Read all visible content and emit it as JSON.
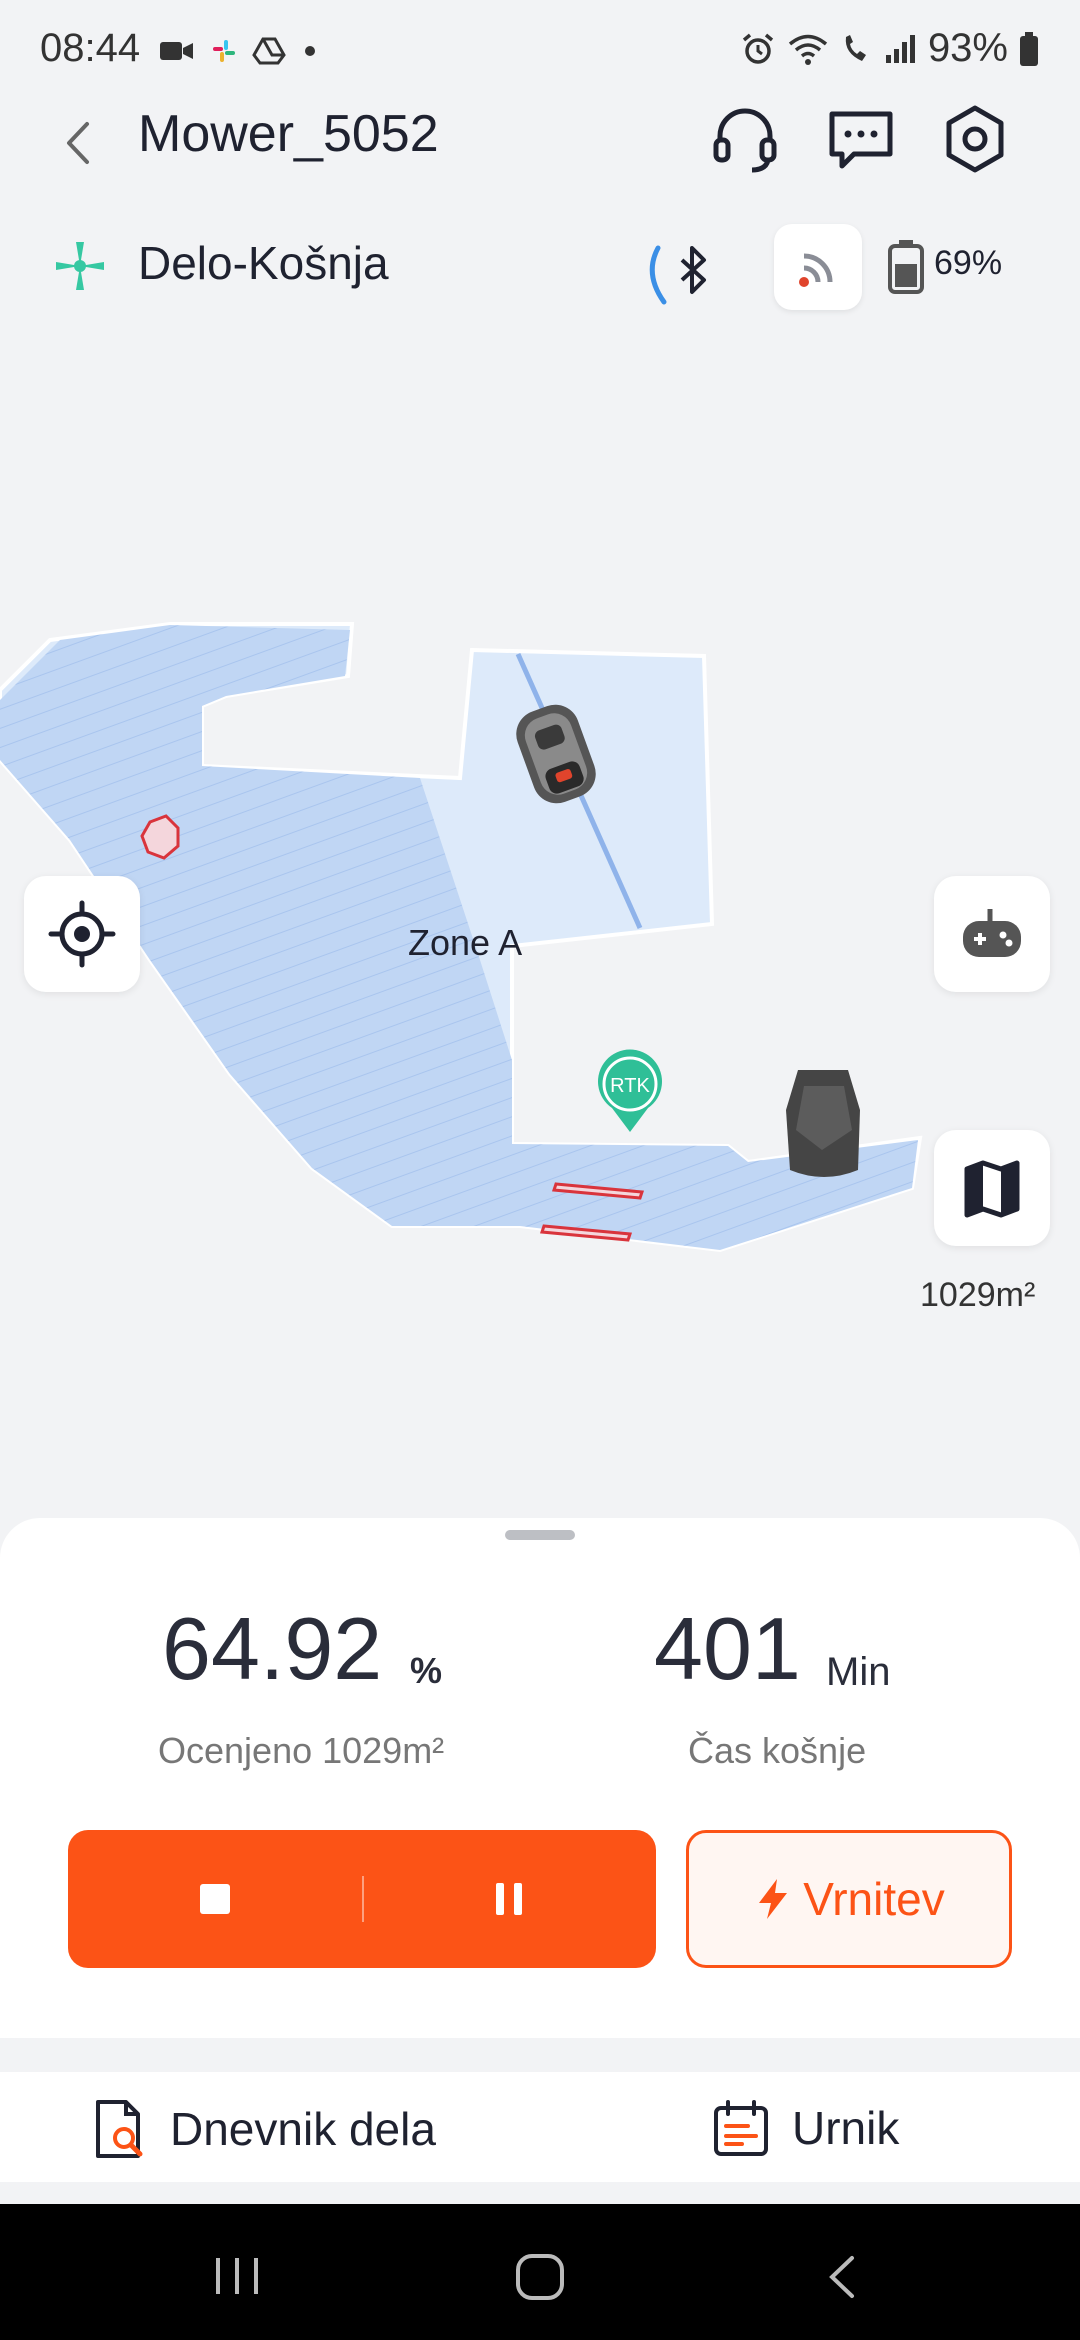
{
  "status_bar": {
    "time": "08:44",
    "battery": "93%"
  },
  "header": {
    "title": "Mower_5052",
    "icons": [
      "back-icon",
      "headset-icon",
      "message-icon",
      "settings-icon"
    ]
  },
  "subheader": {
    "mode_label": "Delo-Košnja",
    "battery_level": "69%"
  },
  "map": {
    "zone_label": "Zone A",
    "rtk_label": "RTK",
    "area": "1029m²"
  },
  "stats": {
    "progress_value": "64.92",
    "progress_unit": "%",
    "progress_caption": "Ocenjeno 1029m²",
    "time_value": "401",
    "time_unit": "Min",
    "time_caption": "Čas košnje"
  },
  "controls": {
    "return_label": "Vrnitev"
  },
  "tabs": {
    "log_label": "Dnevnik dela",
    "schedule_label": "Urnik"
  },
  "colors": {
    "accent": "#fc5316",
    "map_fill": "#c4daf6",
    "background": "#f2f3f5"
  }
}
